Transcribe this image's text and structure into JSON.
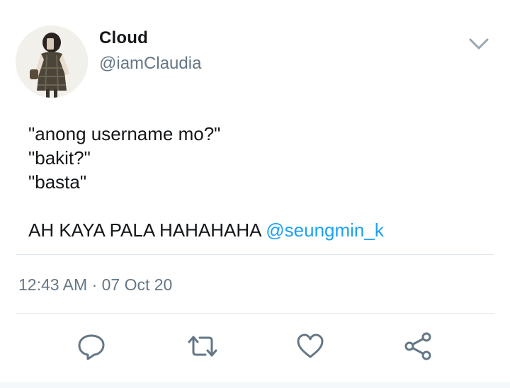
{
  "tweet": {
    "author": {
      "display_name": "Cloud",
      "handle": "@iamClaudia",
      "avatar_icon": "profile-photo"
    },
    "body_lines": [
      "\"anong username mo?\"",
      "\"bakit?\"",
      "\"basta\""
    ],
    "closing_text": "AH KAYA PALA HAHAHAHA ",
    "mention": "@seungmin_k",
    "timestamp": "12:43 AM · 07 Oct 20"
  },
  "actions": [
    {
      "name": "reply",
      "icon": "reply-icon"
    },
    {
      "name": "retweet",
      "icon": "retweet-icon"
    },
    {
      "name": "like",
      "icon": "heart-icon"
    },
    {
      "name": "share",
      "icon": "share-icon"
    }
  ],
  "colors": {
    "text": "#14171a",
    "secondary": "#657786",
    "link": "#1da1f2",
    "divider": "#e1e8ed"
  }
}
